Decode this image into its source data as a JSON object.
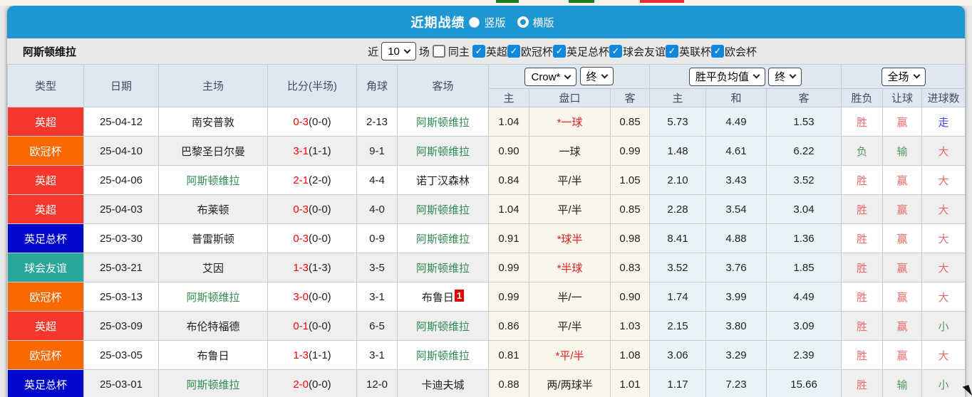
{
  "topbar": {
    "title": "近期战绩",
    "layout_options": [
      {
        "label": "竖版",
        "selected": false
      },
      {
        "label": "横版",
        "selected": true
      }
    ]
  },
  "filterbar": {
    "team_name": "阿斯顿维拉",
    "near_label": "近",
    "count_value": "10",
    "games_label": "场",
    "same_home": {
      "label": "同主",
      "checked": false
    },
    "competitions": [
      {
        "label": "英超",
        "checked": true
      },
      {
        "label": "欧冠杯",
        "checked": true
      },
      {
        "label": "英足总杯",
        "checked": true
      },
      {
        "label": "球会友谊",
        "checked": true
      },
      {
        "label": "英联杯",
        "checked": true
      },
      {
        "label": "欧会杯",
        "checked": true
      }
    ]
  },
  "icons": {
    "check": "✓"
  },
  "table": {
    "controls": {
      "odds_company": "Crow*",
      "odds_time": "终",
      "avg_type": "胜平负均值",
      "avg_time": "终",
      "scope": "全场"
    },
    "headers": {
      "type": "类型",
      "date": "日期",
      "home": "主场",
      "score": "比分(半场)",
      "corner": "角球",
      "away": "客场",
      "odds_home": "主",
      "handicap": "盘口",
      "odds_away": "客",
      "avg_home": "主",
      "avg_draw": "和",
      "avg_away": "客",
      "result": "胜负",
      "handicap_result": "让球",
      "goals": "进球数"
    },
    "rows": [
      {
        "league": "英超",
        "league_color": "#f5372e",
        "date": "25-04-12",
        "home": "南安普敦",
        "home_focus": false,
        "score": "0-3",
        "half": "(0-0)",
        "corner": "2-13",
        "away": "阿斯顿维拉",
        "away_focus": true,
        "away_badge": "",
        "odds_home": "1.04",
        "handicap": "*一球",
        "handicap_red": true,
        "odds_away": "0.85",
        "avg_home": "5.73",
        "avg_draw": "4.49",
        "avg_away": "1.53",
        "result": {
          "text": "胜",
          "color": "red"
        },
        "handicap_result": {
          "text": "赢",
          "color": "red"
        },
        "goals": {
          "text": "走",
          "color": "blue"
        }
      },
      {
        "league": "欧冠杯",
        "league_color": "#f96900",
        "date": "25-04-10",
        "home": "巴黎圣日尔曼",
        "home_focus": false,
        "score": "3-1",
        "half": "(1-1)",
        "corner": "9-1",
        "away": "阿斯顿维拉",
        "away_focus": true,
        "away_badge": "",
        "odds_home": "0.90",
        "handicap": "一球",
        "handicap_red": false,
        "odds_away": "0.99",
        "avg_home": "1.48",
        "avg_draw": "4.61",
        "avg_away": "6.22",
        "result": {
          "text": "负",
          "color": "green"
        },
        "handicap_result": {
          "text": "输",
          "color": "green"
        },
        "goals": {
          "text": "大",
          "color": "red"
        }
      },
      {
        "league": "英超",
        "league_color": "#f5372e",
        "date": "25-04-06",
        "home": "阿斯顿维拉",
        "home_focus": true,
        "score": "2-1",
        "half": "(2-0)",
        "corner": "4-4",
        "away": "诺丁汉森林",
        "away_focus": false,
        "away_badge": "",
        "odds_home": "0.84",
        "handicap": "平/半",
        "handicap_red": false,
        "odds_away": "1.05",
        "avg_home": "2.10",
        "avg_draw": "3.43",
        "avg_away": "3.52",
        "result": {
          "text": "胜",
          "color": "red"
        },
        "handicap_result": {
          "text": "赢",
          "color": "red"
        },
        "goals": {
          "text": "大",
          "color": "red"
        }
      },
      {
        "league": "英超",
        "league_color": "#f5372e",
        "date": "25-04-03",
        "home": "布莱顿",
        "home_focus": false,
        "score": "0-3",
        "half": "(0-0)",
        "corner": "4-0",
        "away": "阿斯顿维拉",
        "away_focus": true,
        "away_badge": "",
        "odds_home": "1.04",
        "handicap": "平/半",
        "handicap_red": false,
        "odds_away": "0.85",
        "avg_home": "2.28",
        "avg_draw": "3.54",
        "avg_away": "3.04",
        "result": {
          "text": "胜",
          "color": "red"
        },
        "handicap_result": {
          "text": "赢",
          "color": "red"
        },
        "goals": {
          "text": "大",
          "color": "red"
        }
      },
      {
        "league": "英足总杯",
        "league_color": "#0008cc",
        "date": "25-03-30",
        "home": "普雷斯顿",
        "home_focus": false,
        "score": "0-3",
        "half": "(0-0)",
        "corner": "0-9",
        "away": "阿斯顿维拉",
        "away_focus": true,
        "away_badge": "",
        "odds_home": "0.91",
        "handicap": "*球半",
        "handicap_red": true,
        "odds_away": "0.98",
        "avg_home": "8.41",
        "avg_draw": "4.88",
        "avg_away": "1.36",
        "result": {
          "text": "胜",
          "color": "red"
        },
        "handicap_result": {
          "text": "赢",
          "color": "red"
        },
        "goals": {
          "text": "大",
          "color": "red"
        }
      },
      {
        "league": "球会友谊",
        "league_color": "#29a79a",
        "date": "25-03-21",
        "home": "艾因",
        "home_focus": false,
        "score": "1-3",
        "half": "(1-3)",
        "corner": "3-5",
        "away": "阿斯顿维拉",
        "away_focus": true,
        "away_badge": "",
        "odds_home": "0.99",
        "handicap": "*半球",
        "handicap_red": true,
        "odds_away": "0.83",
        "avg_home": "3.52",
        "avg_draw": "3.76",
        "avg_away": "1.85",
        "result": {
          "text": "胜",
          "color": "red"
        },
        "handicap_result": {
          "text": "赢",
          "color": "red"
        },
        "goals": {
          "text": "大",
          "color": "red"
        }
      },
      {
        "league": "欧冠杯",
        "league_color": "#f96900",
        "date": "25-03-13",
        "home": "阿斯顿维拉",
        "home_focus": true,
        "score": "3-0",
        "half": "(0-0)",
        "corner": "3-1",
        "away": "布鲁日",
        "away_focus": false,
        "away_badge": "1",
        "odds_home": "0.99",
        "handicap": "半/一",
        "handicap_red": false,
        "odds_away": "0.90",
        "avg_home": "1.74",
        "avg_draw": "3.99",
        "avg_away": "4.49",
        "result": {
          "text": "胜",
          "color": "red"
        },
        "handicap_result": {
          "text": "赢",
          "color": "red"
        },
        "goals": {
          "text": "大",
          "color": "red"
        }
      },
      {
        "league": "英超",
        "league_color": "#f5372e",
        "date": "25-03-09",
        "home": "布伦特福德",
        "home_focus": false,
        "score": "0-1",
        "half": "(0-0)",
        "corner": "6-5",
        "away": "阿斯顿维拉",
        "away_focus": true,
        "away_badge": "",
        "odds_home": "0.86",
        "handicap": "平/半",
        "handicap_red": false,
        "odds_away": "1.03",
        "avg_home": "2.15",
        "avg_draw": "3.80",
        "avg_away": "3.09",
        "result": {
          "text": "胜",
          "color": "red"
        },
        "handicap_result": {
          "text": "赢",
          "color": "red"
        },
        "goals": {
          "text": "小",
          "color": "green"
        }
      },
      {
        "league": "欧冠杯",
        "league_color": "#f96900",
        "date": "25-03-05",
        "home": "布鲁日",
        "home_focus": false,
        "score": "1-3",
        "half": "(1-1)",
        "corner": "3-1",
        "away": "阿斯顿维拉",
        "away_focus": true,
        "away_badge": "",
        "odds_home": "0.81",
        "handicap": "*平/半",
        "handicap_red": true,
        "odds_away": "1.08",
        "avg_home": "3.06",
        "avg_draw": "3.29",
        "avg_away": "2.39",
        "result": {
          "text": "胜",
          "color": "red"
        },
        "handicap_result": {
          "text": "赢",
          "color": "red"
        },
        "goals": {
          "text": "大",
          "color": "red"
        }
      },
      {
        "league": "英足总杯",
        "league_color": "#0008cc",
        "date": "25-03-01",
        "home": "阿斯顿维拉",
        "home_focus": true,
        "score": "2-0",
        "half": "(0-0)",
        "corner": "12-0",
        "away": "卡迪夫城",
        "away_focus": false,
        "away_badge": "",
        "odds_home": "0.88",
        "handicap": "两/两球半",
        "handicap_red": false,
        "odds_away": "1.01",
        "avg_home": "1.17",
        "avg_draw": "7.23",
        "avg_away": "15.66",
        "result": {
          "text": "胜",
          "color": "red"
        },
        "handicap_result": {
          "text": "输",
          "color": "green"
        },
        "goals": {
          "text": "小",
          "color": "green"
        }
      }
    ]
  }
}
